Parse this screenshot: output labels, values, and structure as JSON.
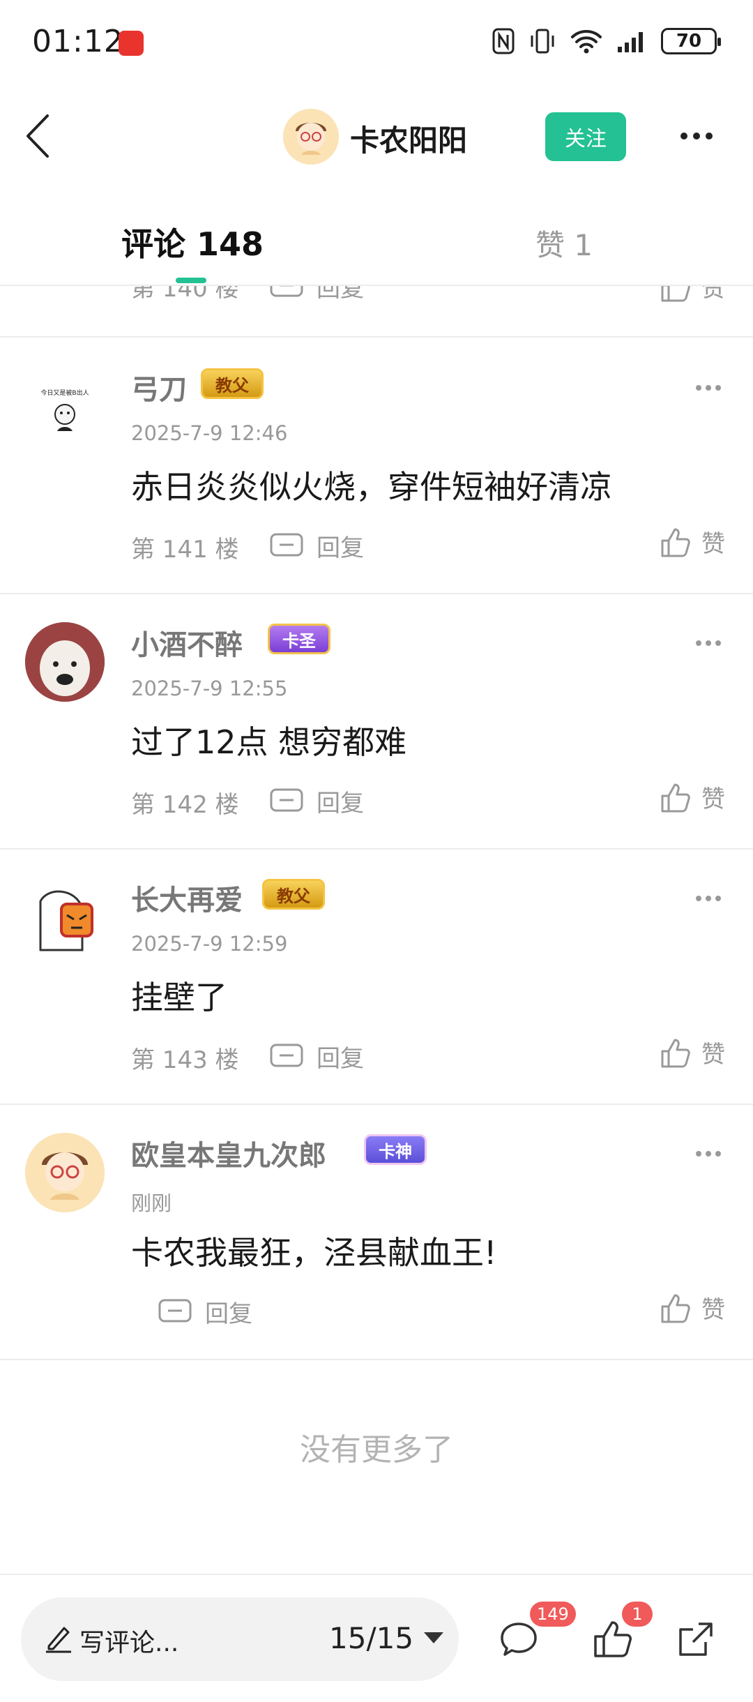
{
  "status": {
    "time": "01:12",
    "battery": "70"
  },
  "header": {
    "name": "卡农阳阳",
    "follow_label": "关注"
  },
  "tabs": {
    "comments": "评论 148",
    "likes": "赞 1"
  },
  "partial": {
    "floor": "第 140 楼",
    "reply": "回复",
    "like": "赞"
  },
  "comments": [
    {
      "name": "弓刀",
      "badge": "教父",
      "date": "2025-7-9 12:46",
      "text": "赤日炎炎似火烧，穿件短袖好清凉",
      "floor": "第 141 楼",
      "reply": "回复",
      "like": "赞",
      "avatar_text": "今日又是被B出人"
    },
    {
      "name": "小酒不醉",
      "badge": "卡圣",
      "date": "2025-7-9 12:55",
      "text": "过了12点 想穷都难",
      "floor": "第 142 楼",
      "reply": "回复",
      "like": "赞"
    },
    {
      "name": "长大再爱",
      "badge": "教父",
      "date": "2025-7-9 12:59",
      "text": "挂壁了",
      "floor": "第 143 楼",
      "reply": "回复",
      "like": "赞"
    },
    {
      "name": "欧皇本皇九次郎",
      "badge": "卡神",
      "date": "刚刚",
      "text": "卡农我最狂，泾县献血王!",
      "reply": "回复",
      "like": "赞"
    }
  ],
  "footer": {
    "no_more": "没有更多了"
  },
  "bottom_bar": {
    "placeholder": "写评论...",
    "page": "15/15",
    "comment_count": "149",
    "like_count": "1"
  },
  "colors": {
    "accent": "#23c193",
    "badge_red": "#f05a5a"
  }
}
